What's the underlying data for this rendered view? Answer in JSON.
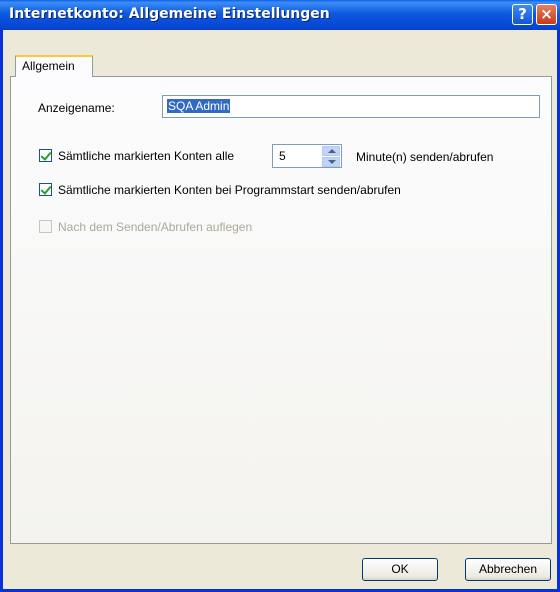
{
  "window": {
    "title": "Internetkonto: Allgemeine Einstellungen",
    "help_glyph": "?",
    "close_glyph": "×"
  },
  "tab": {
    "label": "Allgemein"
  },
  "display_name": {
    "label": "Anzeigename:",
    "value": "SQA Admin"
  },
  "check_interval": {
    "label": "Sämtliche markierten Konten alle",
    "checked": true,
    "value": "5",
    "suffix": "Minute(n) senden/abrufen"
  },
  "check_startup": {
    "label": "Sämtliche markierten Konten bei Programmstart senden/abrufen",
    "checked": true
  },
  "hangup": {
    "label": "Nach dem Senden/Abrufen auflegen",
    "checked": false,
    "disabled": true
  },
  "buttons": {
    "ok": "OK",
    "cancel": "Abbrechen"
  },
  "colors": {
    "title_bar": "#0a5fe8",
    "tab_accent": "#ffc83c",
    "selection": "#316ac5",
    "check": "#21a121"
  }
}
